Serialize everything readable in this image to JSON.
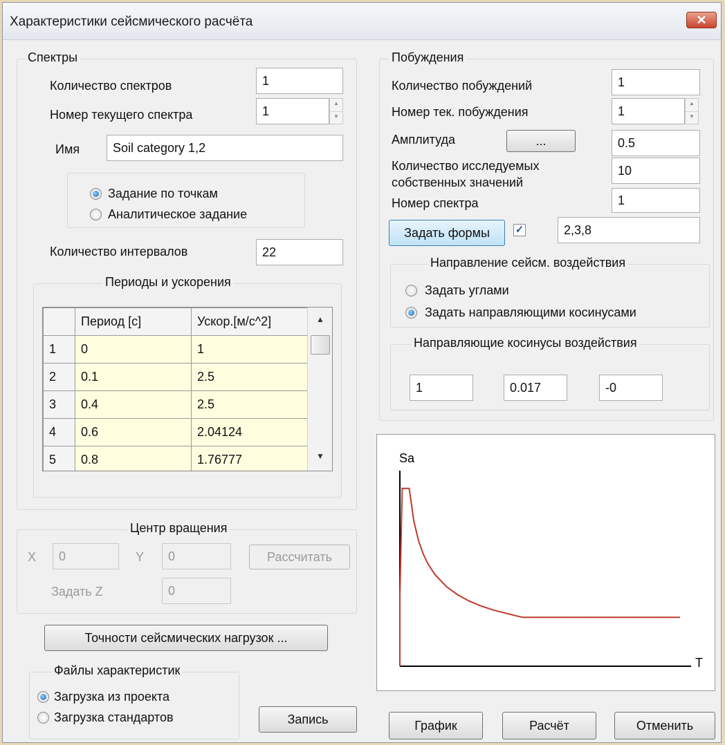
{
  "window": {
    "title": "Характеристики сейсмического расчёта",
    "close_glyph": "✕"
  },
  "spectra": {
    "group_title": "Спектры",
    "count_label": "Количество спектров",
    "count_value": "1",
    "current_label": "Номер текущего спектра",
    "current_value": "1",
    "name_label": "Имя",
    "name_value": "Soil category 1,2",
    "mode_points": "Задание по точкам",
    "mode_analytic": "Аналитическое задание",
    "intervals_label": "Количество интервалов",
    "intervals_value": "22",
    "table_group_title": "Периоды и ускорения",
    "table": {
      "col_period": "Период [с]",
      "col_accel": "Ускор.[м/с^2]",
      "rows": [
        {
          "n": "1",
          "period": "0",
          "accel": "1"
        },
        {
          "n": "2",
          "period": "0.1",
          "accel": "2.5"
        },
        {
          "n": "3",
          "period": "0.4",
          "accel": "2.5"
        },
        {
          "n": "4",
          "period": "0.6",
          "accel": "2.04124"
        },
        {
          "n": "5",
          "period": "0.8",
          "accel": "1.76777"
        }
      ]
    }
  },
  "rotation": {
    "group_title": "Центр вращения",
    "x_label": "X",
    "x_value": "0",
    "y_label": "Y",
    "y_value": "0",
    "z_label": "Задать Z",
    "z_value": "0",
    "calc_button": "Рассчитать"
  },
  "accuracy_button": "Точности сейсмических нагрузок ...",
  "files": {
    "group_title": "Файлы характеристик",
    "from_project": "Загрузка из проекта",
    "standards": "Загрузка стандартов",
    "save_button": "Запись"
  },
  "excitations": {
    "group_title": "Побуждения",
    "count_label": "Количество побуждений",
    "count_value": "1",
    "current_label": "Номер тек. побуждения",
    "current_value": "1",
    "amplitude_label": "Амплитуда",
    "amplitude_button": "...",
    "amplitude_value": "0.5",
    "eigen_label_1": "Количество исследуемых",
    "eigen_label_2": "собственных значений",
    "eigen_value": "10",
    "spectrum_label": "Номер спектра",
    "spectrum_value": "1",
    "forms_button": "Задать формы",
    "forms_checked": true,
    "forms_value": "2,3,8"
  },
  "direction": {
    "group_title": "Направление сейсм. воздействия",
    "by_angles": "Задать углами",
    "by_cosines": "Задать направляющими косинусами"
  },
  "cosines": {
    "group_title": "Направляющие косинусы воздействия",
    "c1": "1",
    "c2": "0.017",
    "c3": "-0"
  },
  "chart_data": {
    "type": "line",
    "xlabel": "T",
    "ylabel": "Sa",
    "x": [
      0,
      0.1,
      0.4,
      0.6,
      0.8,
      1.0,
      1.2,
      1.5,
      2.0,
      2.5,
      3.0,
      3.5,
      4.0,
      5.0,
      5.3,
      6.0,
      7.0,
      8.0,
      9.0,
      10.0,
      11.0,
      12.0
    ],
    "series": [
      {
        "values": [
          1,
          2.5,
          2.5,
          2.04124,
          1.76777,
          1.58114,
          1.44338,
          1.29099,
          1.11803,
          1.0,
          0.91287,
          0.84515,
          0.79057,
          0.70711,
          0.6868,
          0.6868,
          0.6868,
          0.6868,
          0.6868,
          0.6868,
          0.6868,
          0.6868
        ]
      }
    ],
    "xlim": [
      0,
      12.5
    ],
    "ylim": [
      0,
      2.75
    ],
    "grid": false,
    "color": "#c0392b"
  },
  "buttons": {
    "plot": "График",
    "calc": "Расчёт",
    "cancel": "Отменить"
  }
}
